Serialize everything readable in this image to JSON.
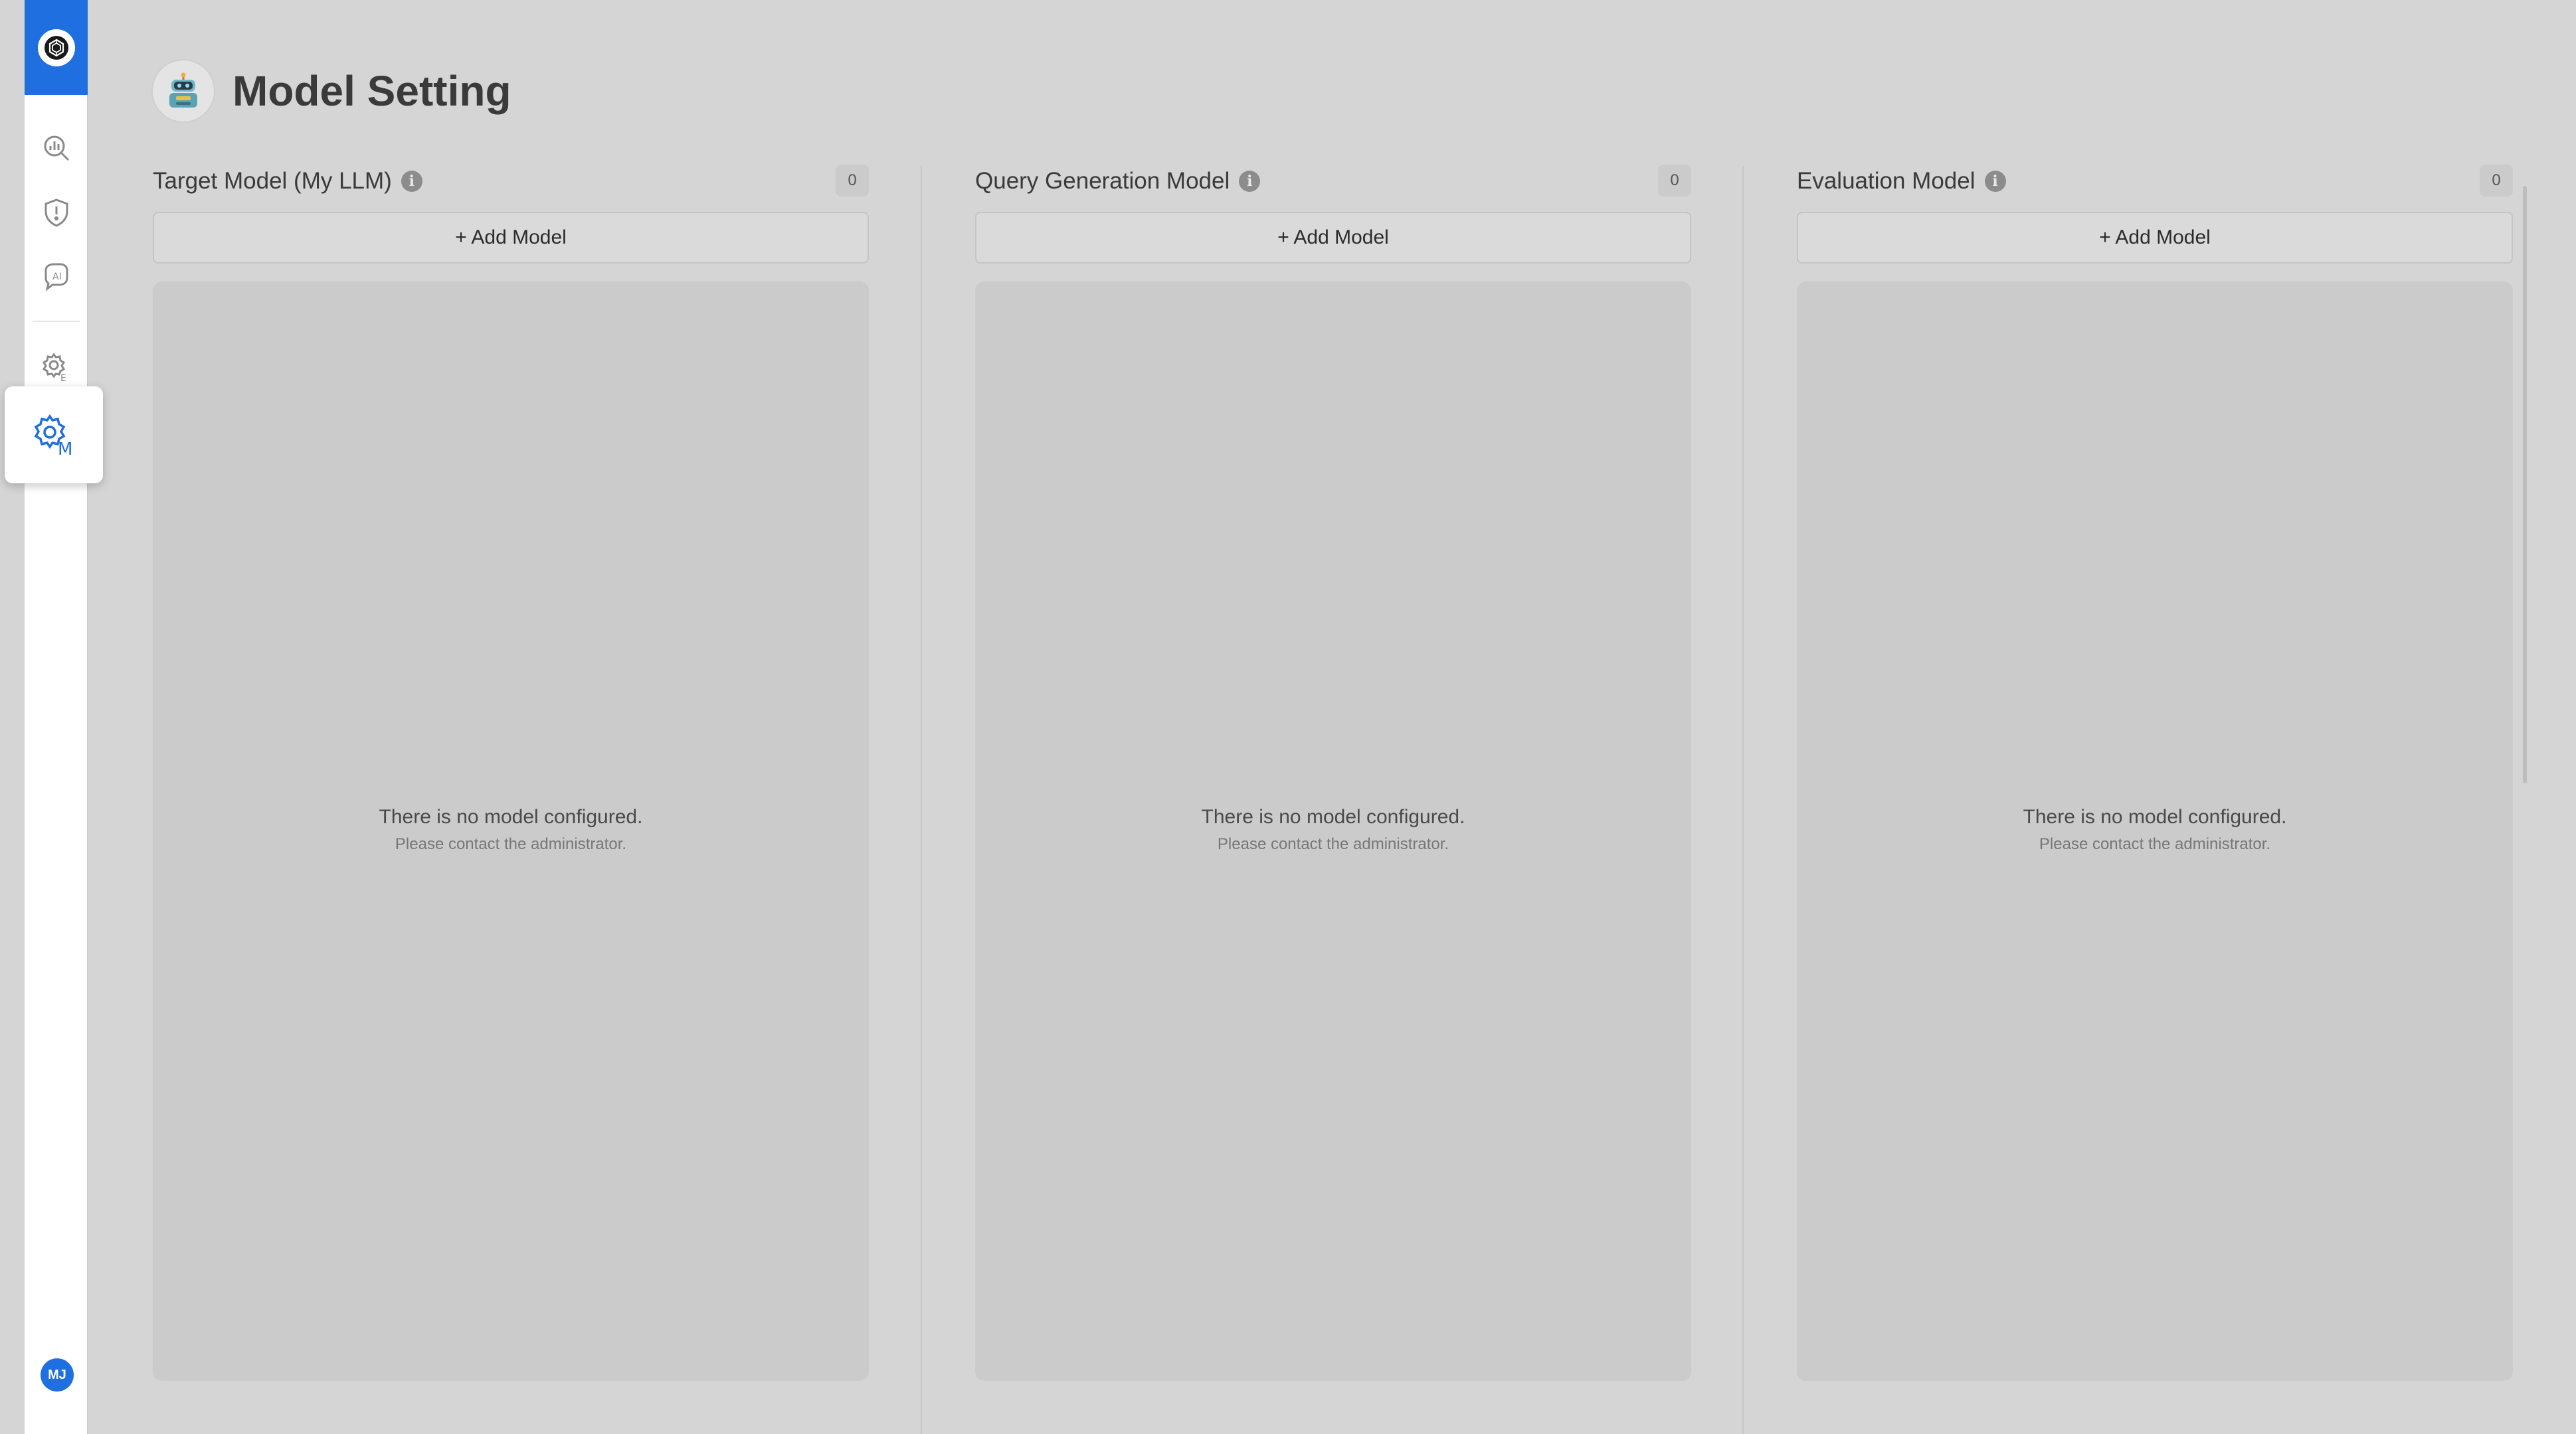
{
  "page": {
    "title": "Model Setting"
  },
  "sidebar": {
    "avatar_initials": "MJ",
    "icons": [
      "logo-icon",
      "analytics-search-icon",
      "shield-alert-icon",
      "ai-review-icon",
      "settings-e-icon",
      "settings-m-icon"
    ]
  },
  "columns": [
    {
      "title": "Target Model (My LLM)",
      "count": "0",
      "add_label": "+ Add Model",
      "empty_title": "There is no model configured.",
      "empty_subtitle": "Please contact the administrator."
    },
    {
      "title": "Query Generation Model",
      "count": "0",
      "add_label": "+ Add Model",
      "empty_title": "There is no model configured.",
      "empty_subtitle": "Please contact the administrator."
    },
    {
      "title": "Evaluation Model",
      "count": "0",
      "add_label": "+ Add Model",
      "empty_title": "There is no model configured.",
      "empty_subtitle": "Please contact the administrator."
    }
  ],
  "colors": {
    "accent": "#1f6fe0",
    "background": "#d5d5d5",
    "panel": "#cbcbcb"
  }
}
